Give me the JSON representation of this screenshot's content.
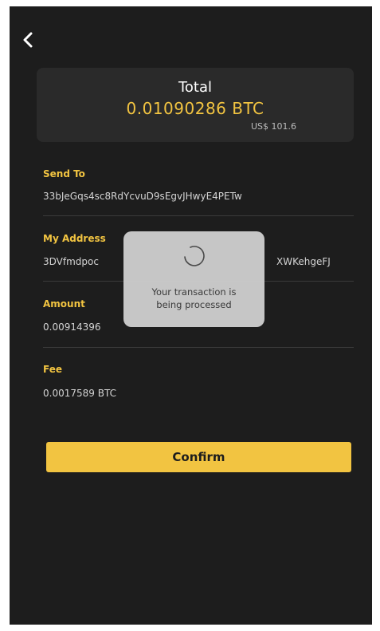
{
  "summary": {
    "title": "Total",
    "amount": "0.01090286 BTC",
    "fiat": "US$ 101.6"
  },
  "send_to": {
    "label": "Send To",
    "value": "33bJeGqs4sc8RdYcvuD9sEgvJHwyE4PETw"
  },
  "my_address": {
    "label": "My Address",
    "value_start": "3DVfmdpoc",
    "value_end": "XWKehgeFJ"
  },
  "amount": {
    "label": "Amount",
    "value": "0.00914396"
  },
  "fee": {
    "label": "Fee",
    "value": "0.0017589 BTC"
  },
  "confirm_label": "Confirm",
  "toast": {
    "line1": "Your transaction is",
    "line2": "being processed"
  },
  "colors": {
    "background": "#1d1d1d",
    "card": "#2a2a2a",
    "accent": "#f2c441",
    "toast": "#cdcdcd"
  },
  "icons": {
    "back": "chevron-left-icon",
    "loading": "spinner-icon"
  }
}
